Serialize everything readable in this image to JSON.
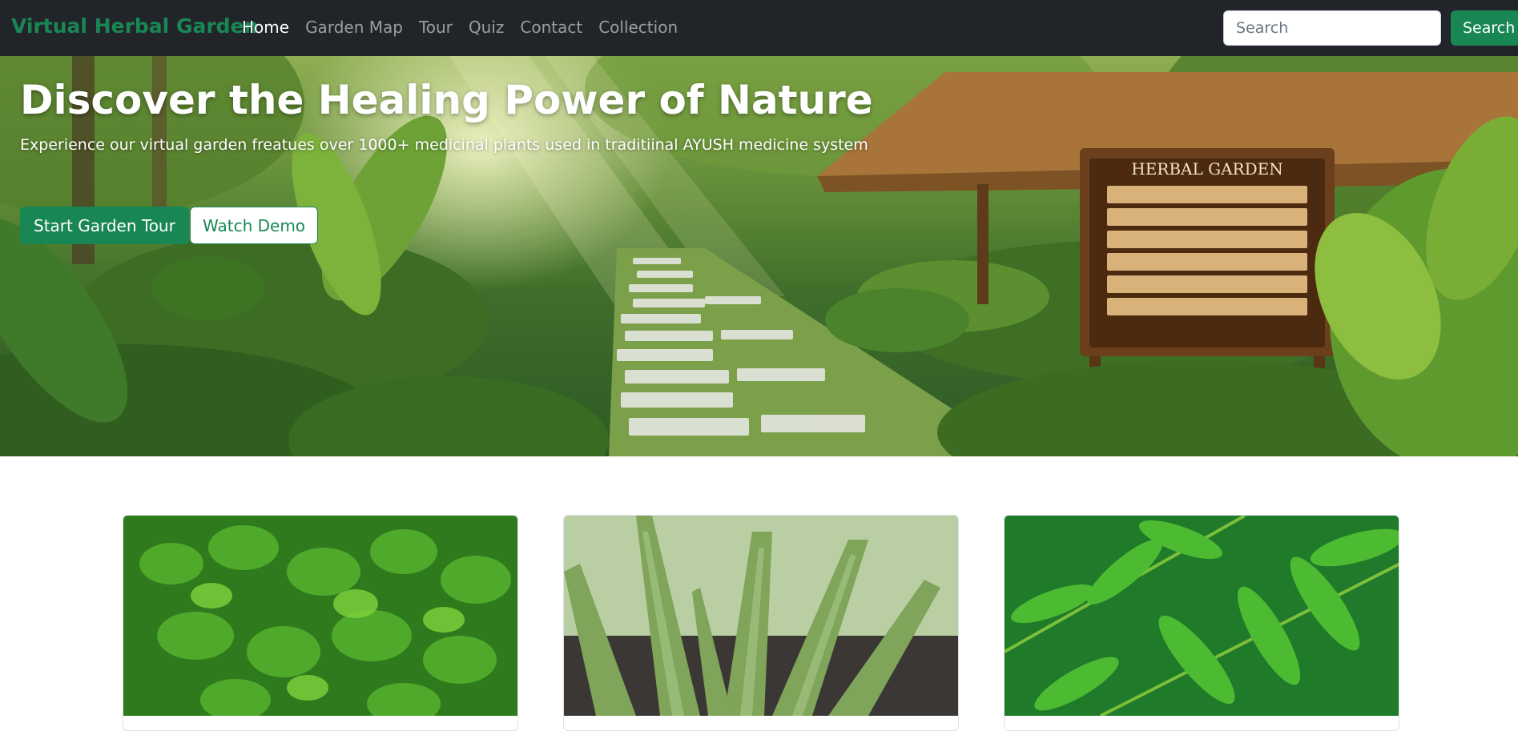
{
  "navbar": {
    "brand": "Virtual Herbal Garden",
    "links": [
      {
        "label": "Home",
        "active": true
      },
      {
        "label": "Garden Map",
        "active": false
      },
      {
        "label": "Tour",
        "active": false
      },
      {
        "label": "Quiz",
        "active": false
      },
      {
        "label": "Contact",
        "active": false
      },
      {
        "label": "Collection",
        "active": false
      }
    ],
    "search_placeholder": "Search",
    "search_button": "Search"
  },
  "hero": {
    "title": "Discover the Healing Power of Nature",
    "subtitle": "Experience our virtual garden freatues over 1000+ medicinal plants used in traditiinal AYUSH medicine system",
    "primary_button": "Start Garden Tour",
    "secondary_button": "Watch Demo",
    "sign_text": "HERBAL GARDEN"
  },
  "cards": [
    {
      "image": "tulsi-plant-photo"
    },
    {
      "image": "aloe-vera-plant-photo"
    },
    {
      "image": "neem-leaves-photo"
    }
  ],
  "colors": {
    "navbar_bg": "#212529",
    "brand": "#198754",
    "primary": "#198754"
  }
}
